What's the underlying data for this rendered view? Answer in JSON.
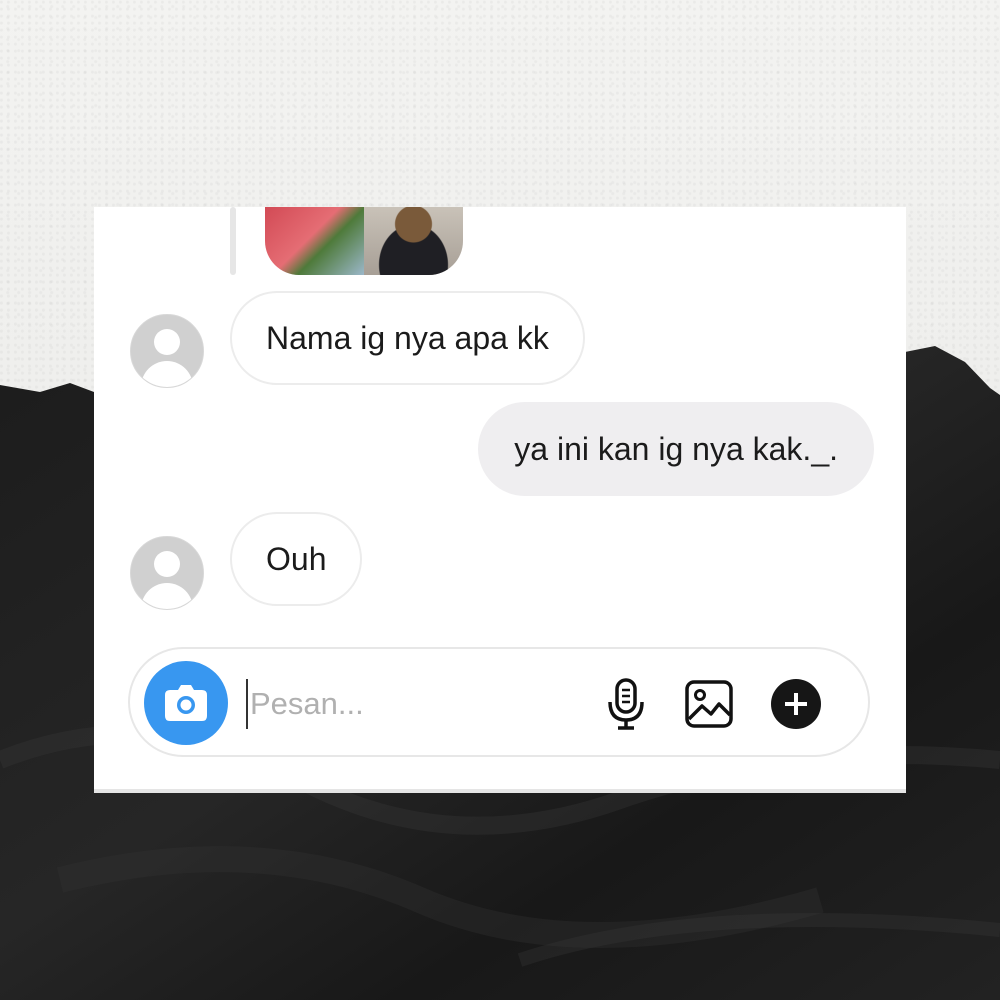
{
  "chat": {
    "messages": [
      {
        "sender": "other",
        "text": "Nama ig nya apa kk"
      },
      {
        "sender": "me",
        "text": "ya ini kan ig nya kak._."
      },
      {
        "sender": "other",
        "text": "Ouh"
      }
    ]
  },
  "composer": {
    "placeholder": "Pesan...",
    "value": ""
  },
  "icons": {
    "camera": "camera-icon",
    "mic": "microphone-icon",
    "gallery": "image-icon",
    "more": "plus-circle-icon"
  },
  "colors": {
    "accent": "#3897f0",
    "outgoing_bubble": "#efeef0",
    "avatar_placeholder": "#d0d0d0"
  }
}
